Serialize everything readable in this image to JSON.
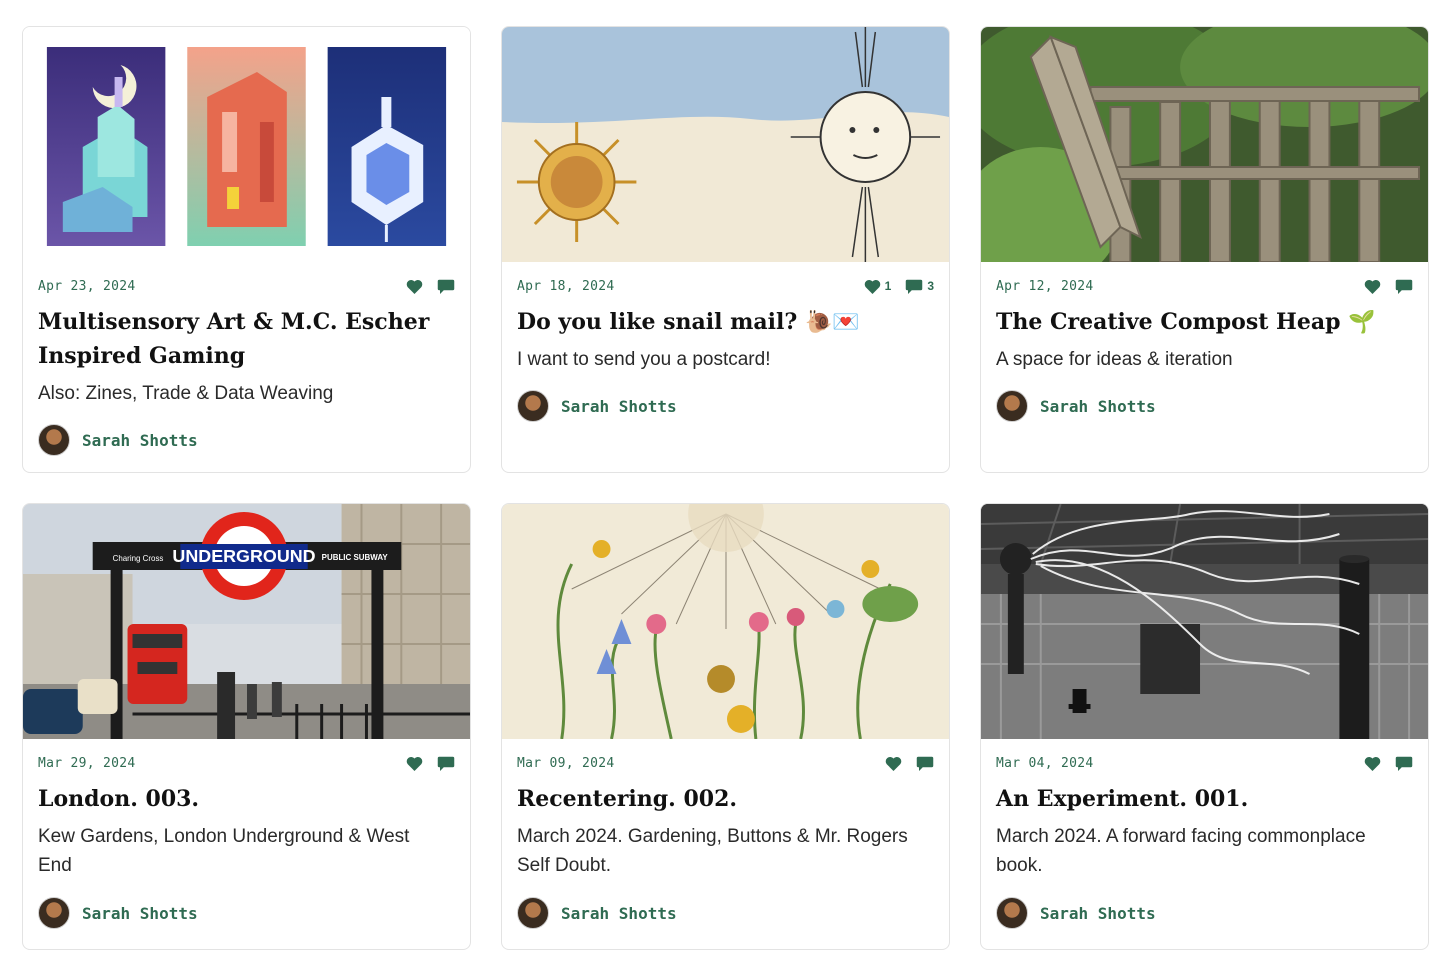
{
  "cards": [
    {
      "date": "Apr 23, 2024",
      "title": "Multisensory Art & M.C. Escher Inspired Gaming",
      "subtitle": "Also: Zines, Trade & Data Weaving",
      "author": "Sarah Shotts",
      "image": "Three isometric game-art panels"
    },
    {
      "date": "Apr 18, 2024",
      "title": "Do you like snail mail? 🐌💌",
      "subtitle": "I want to send you a postcard!",
      "author": "Sarah Shotts",
      "likes": "1",
      "comments": "3",
      "image": "Antique illustration of two suns"
    },
    {
      "date": "Apr 12, 2024",
      "title": "The Creative Compost Heap 🌱",
      "subtitle": "A space for ideas & iteration",
      "author": "Sarah Shotts",
      "image": "Wooden pallet compost bin"
    },
    {
      "date": "Mar 29, 2024",
      "title": "London. 003.",
      "subtitle": "Kew Gardens, London Underground & West End",
      "author": "Sarah Shotts",
      "image": "London Underground entrance",
      "sign": {
        "left": "Charing Cross",
        "center": "UNDERGROUND",
        "right": "PUBLIC SUBWAY"
      }
    },
    {
      "date": "Mar 09, 2024",
      "title": "Recentering. 002.",
      "subtitle": "March 2024. Gardening, Buttons & Mr. Rogers Self Doubt.",
      "author": "Sarah Shotts",
      "image": "Botanical flower dial illustration"
    },
    {
      "date": "Mar 04, 2024",
      "title": "An Experiment. 001.",
      "subtitle": "March 2024. A forward facing commonplace book.",
      "author": "Sarah Shotts",
      "image": "Black and white photo of electrical sparks"
    }
  ],
  "colors": {
    "accent": "#2f6b52",
    "border": "#e3e3e3"
  },
  "icons": {
    "like": "heart-icon",
    "comment": "comment-icon"
  }
}
